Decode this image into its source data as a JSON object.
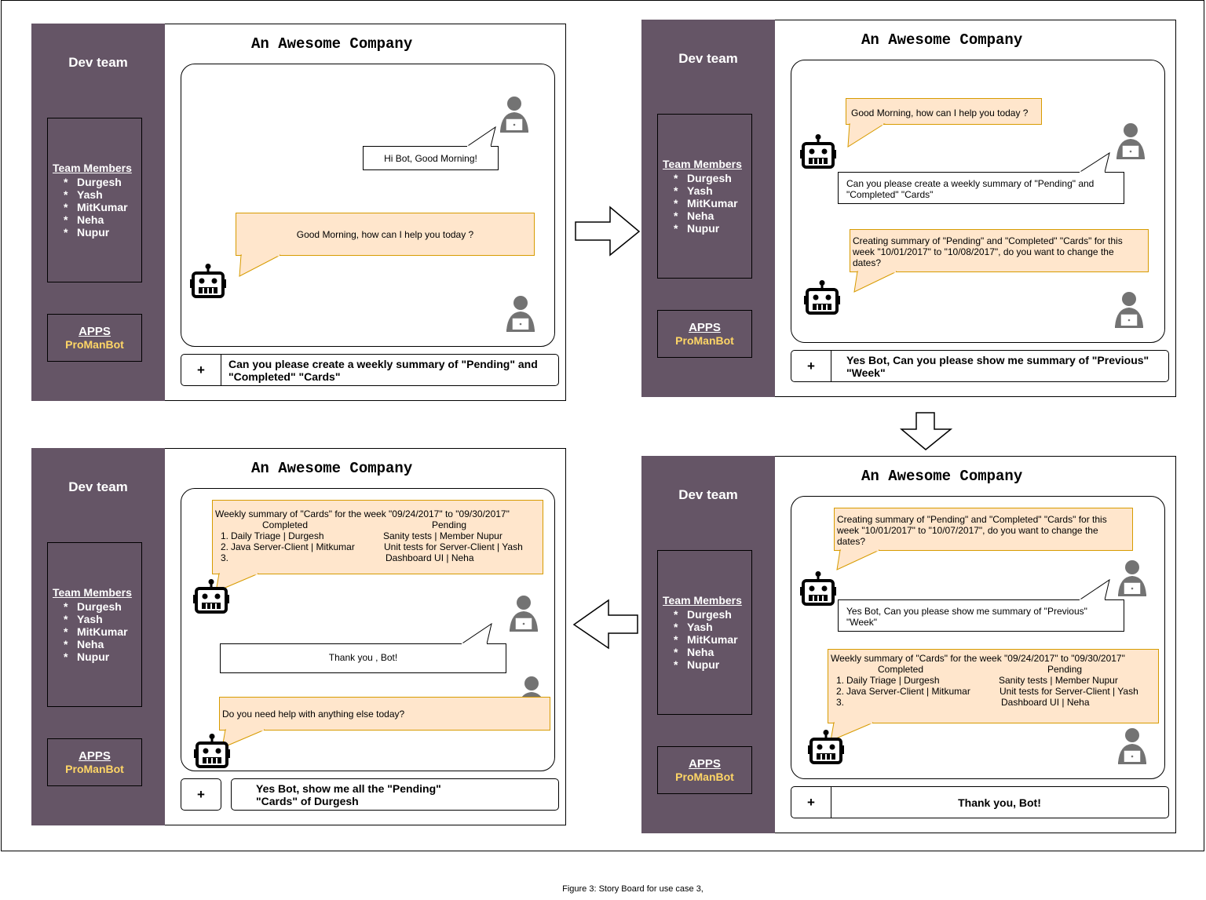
{
  "caption": "Figure 3: Story Board for use case 3,",
  "common": {
    "sidebar_title": "Dev team",
    "members_heading": "Team Members",
    "members": [
      "Durgesh",
      "Yash",
      "MitKumar",
      "Neha",
      "Nupur"
    ],
    "apps_heading": "APPS",
    "app_name": "ProManBot",
    "company": "An Awesome Company",
    "plus": "+"
  },
  "panels": [
    {
      "input": "Can you please create a weekly summary of \"Pending\" and \"Completed\" \"Cards\"",
      "messages": [
        {
          "from": "user",
          "text": "Hi Bot, Good Morning!"
        },
        {
          "from": "bot",
          "text": "Good Morning, how can I help you today ?"
        }
      ]
    },
    {
      "input": "Yes Bot, Can you please show me summary of \"Previous\" \"Week\"",
      "messages": [
        {
          "from": "bot",
          "text": "Good Morning, how can I help you today ?"
        },
        {
          "from": "user",
          "text": "Can you please create a weekly summary of \"Pending\" and \"Completed\" \"Cards\""
        },
        {
          "from": "bot",
          "text": "Creating summary of \"Pending\" and \"Completed\" \"Cards\" for this week \"10/01/2017\" to \"10/08/2017\", do you want to change the dates?"
        }
      ]
    },
    {
      "input": "Thank you, Bot!",
      "messages": [
        {
          "from": "bot",
          "text": "Creating summary of \"Pending\" and \"Completed\" \"Cards\" for this week \"10/01/2017\" to \"10/07/2017\", do you want to change the dates?"
        },
        {
          "from": "user",
          "text": "Yes Bot, Can you please show me summary of \"Previous\" \"Week\""
        },
        {
          "from": "bot",
          "summary": true
        }
      ]
    },
    {
      "input": "Yes Bot, show me all the \"Pending\" \"Cards\" of Durgesh",
      "messages": [
        {
          "from": "bot",
          "summary": true
        },
        {
          "from": "user",
          "text": "Thank you , Bot!"
        },
        {
          "from": "bot",
          "text": "Do you need help with anything else today?"
        }
      ]
    }
  ],
  "summary": {
    "title": "Weekly summary of \"Cards\" for the week \"09/24/2017\" to \"09/30/2017\"",
    "completed_heading": "Completed",
    "pending_heading": "Pending",
    "rows": [
      {
        "num": "1.",
        "completed": "Daily Triage |  Durgesh",
        "pending": "Sanity tests | Member Nupur"
      },
      {
        "num": "2.",
        "completed": "Java Server-Client | Mitkumar",
        "pending": "Unit tests for Server-Client | Yash"
      },
      {
        "num": "3.",
        "completed": "",
        "pending": "Dashboard UI  |  Neha"
      }
    ]
  },
  "icons": {
    "bot": "robot-icon",
    "user": "user-laptop-icon",
    "flow": "flow-arrow"
  }
}
